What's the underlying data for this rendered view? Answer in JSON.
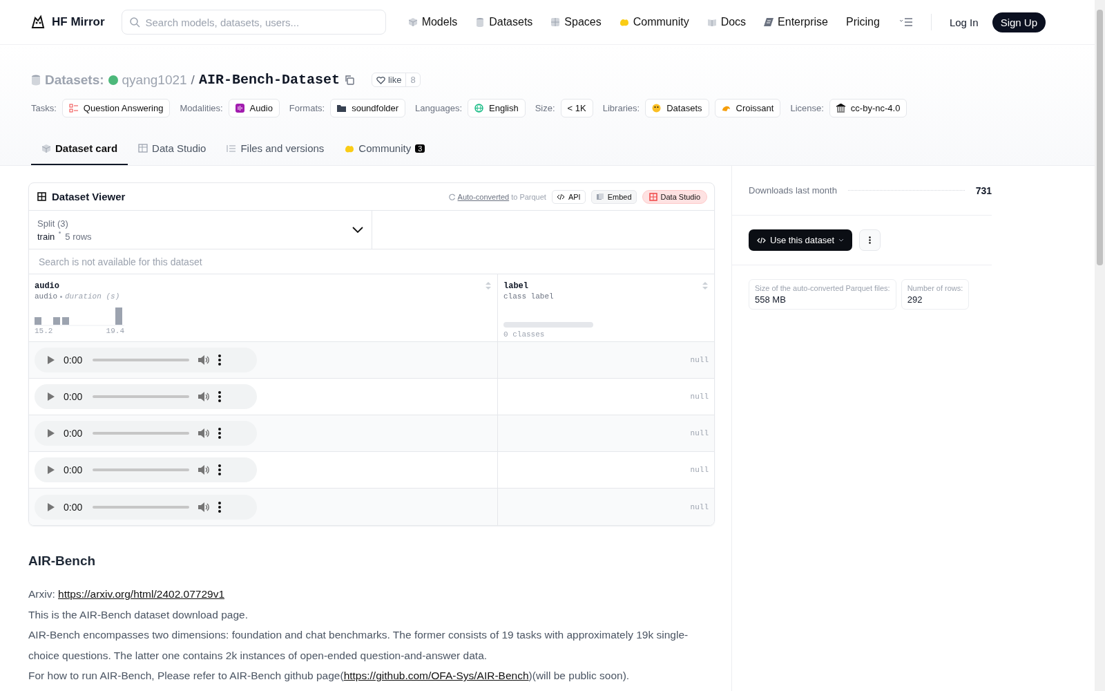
{
  "header": {
    "logo": "HF Mirror",
    "search": {
      "placeholder": "Search models, datasets, users..."
    },
    "nav": [
      {
        "label": "Models"
      },
      {
        "label": "Datasets"
      },
      {
        "label": "Spaces"
      },
      {
        "label": "Community"
      },
      {
        "label": "Docs"
      },
      {
        "label": "Enterprise"
      },
      {
        "label": "Pricing"
      }
    ],
    "login": "Log In",
    "signup": "Sign Up"
  },
  "title": {
    "prefix": "Datasets:",
    "owner": "qyang1021",
    "separator": "/",
    "name": "AIR-Bench-Dataset",
    "like": "like",
    "likes": "8"
  },
  "tag_groups": [
    {
      "label": "Tasks:",
      "items": [
        "Question Answering"
      ]
    },
    {
      "label": "Modalities:",
      "items": [
        "Audio"
      ]
    },
    {
      "label": "Formats:",
      "items": [
        "soundfolder"
      ]
    },
    {
      "label": "Languages:",
      "items": [
        "English"
      ]
    },
    {
      "label": "Size:",
      "items": [
        "< 1K"
      ]
    },
    {
      "label": "Libraries:",
      "items": [
        "Datasets",
        "Croissant"
      ]
    },
    {
      "label": "License:",
      "items": [
        "cc-by-nc-4.0"
      ]
    }
  ],
  "tabs": [
    {
      "label": "Dataset card",
      "selected": true
    },
    {
      "label": "Data Studio",
      "selected": false
    },
    {
      "label": "Files and versions",
      "selected": false
    },
    {
      "label": "Community",
      "selected": false,
      "badge": "3"
    }
  ],
  "viewer": {
    "title": "Dataset Viewer",
    "auto": "Auto-converted",
    "to_parquet": "to Parquet",
    "buttons": [
      "API",
      "Embed",
      "Data Studio"
    ],
    "split": {
      "label": "Split (3)",
      "value": "train",
      "rows": "5 rows"
    },
    "search": {
      "placeholder": "Search is not available for this dataset"
    },
    "columns": [
      {
        "name": "audio",
        "type": "audio",
        "subtype": "duration (s)",
        "min": "15.2",
        "max": "19.4"
      },
      {
        "name": "label",
        "type": "class label",
        "summary": "0 classes"
      }
    ],
    "rows": [
      {
        "time": "0:00",
        "label": "null"
      },
      {
        "time": "0:00",
        "label": "null"
      },
      {
        "time": "0:00",
        "label": "null"
      },
      {
        "time": "0:00",
        "label": "null"
      },
      {
        "time": "0:00",
        "label": "null"
      }
    ]
  },
  "readme": {
    "heading": "AIR-Bench",
    "paragraphs": [
      [
        {
          "kind": "text",
          "text": "Arxiv: "
        },
        {
          "kind": "link",
          "text": "https://arxiv.org/html/2402.07729v1"
        }
      ],
      [
        {
          "kind": "text",
          "text": "This is the AIR-Bench dataset download page."
        }
      ],
      [
        {
          "kind": "text",
          "text": "AIR-Bench encompasses two dimensions: foundation and chat benchmarks. The former consists of 19 tasks with approximately 19k single-choice questions. The latter one contains 2k instances of open-ended question-and-answer data."
        }
      ],
      [
        {
          "kind": "text",
          "text": "For how to run AIR-Bench, Please refer to AIR-Bench github page("
        },
        {
          "kind": "link",
          "text": "https://github.com/OFA-Sys/AIR-Bench"
        },
        {
          "kind": "text",
          "text": ")(will be public soon)."
        }
      ]
    ]
  },
  "sidebar": {
    "downloads_label": "Downloads last month",
    "downloads": "731",
    "use_button": "Use this dataset",
    "stats": [
      {
        "label": "Size of the auto-converted Parquet files:",
        "value": "558 MB"
      },
      {
        "label": "Number of rows:",
        "value": "292"
      }
    ]
  }
}
